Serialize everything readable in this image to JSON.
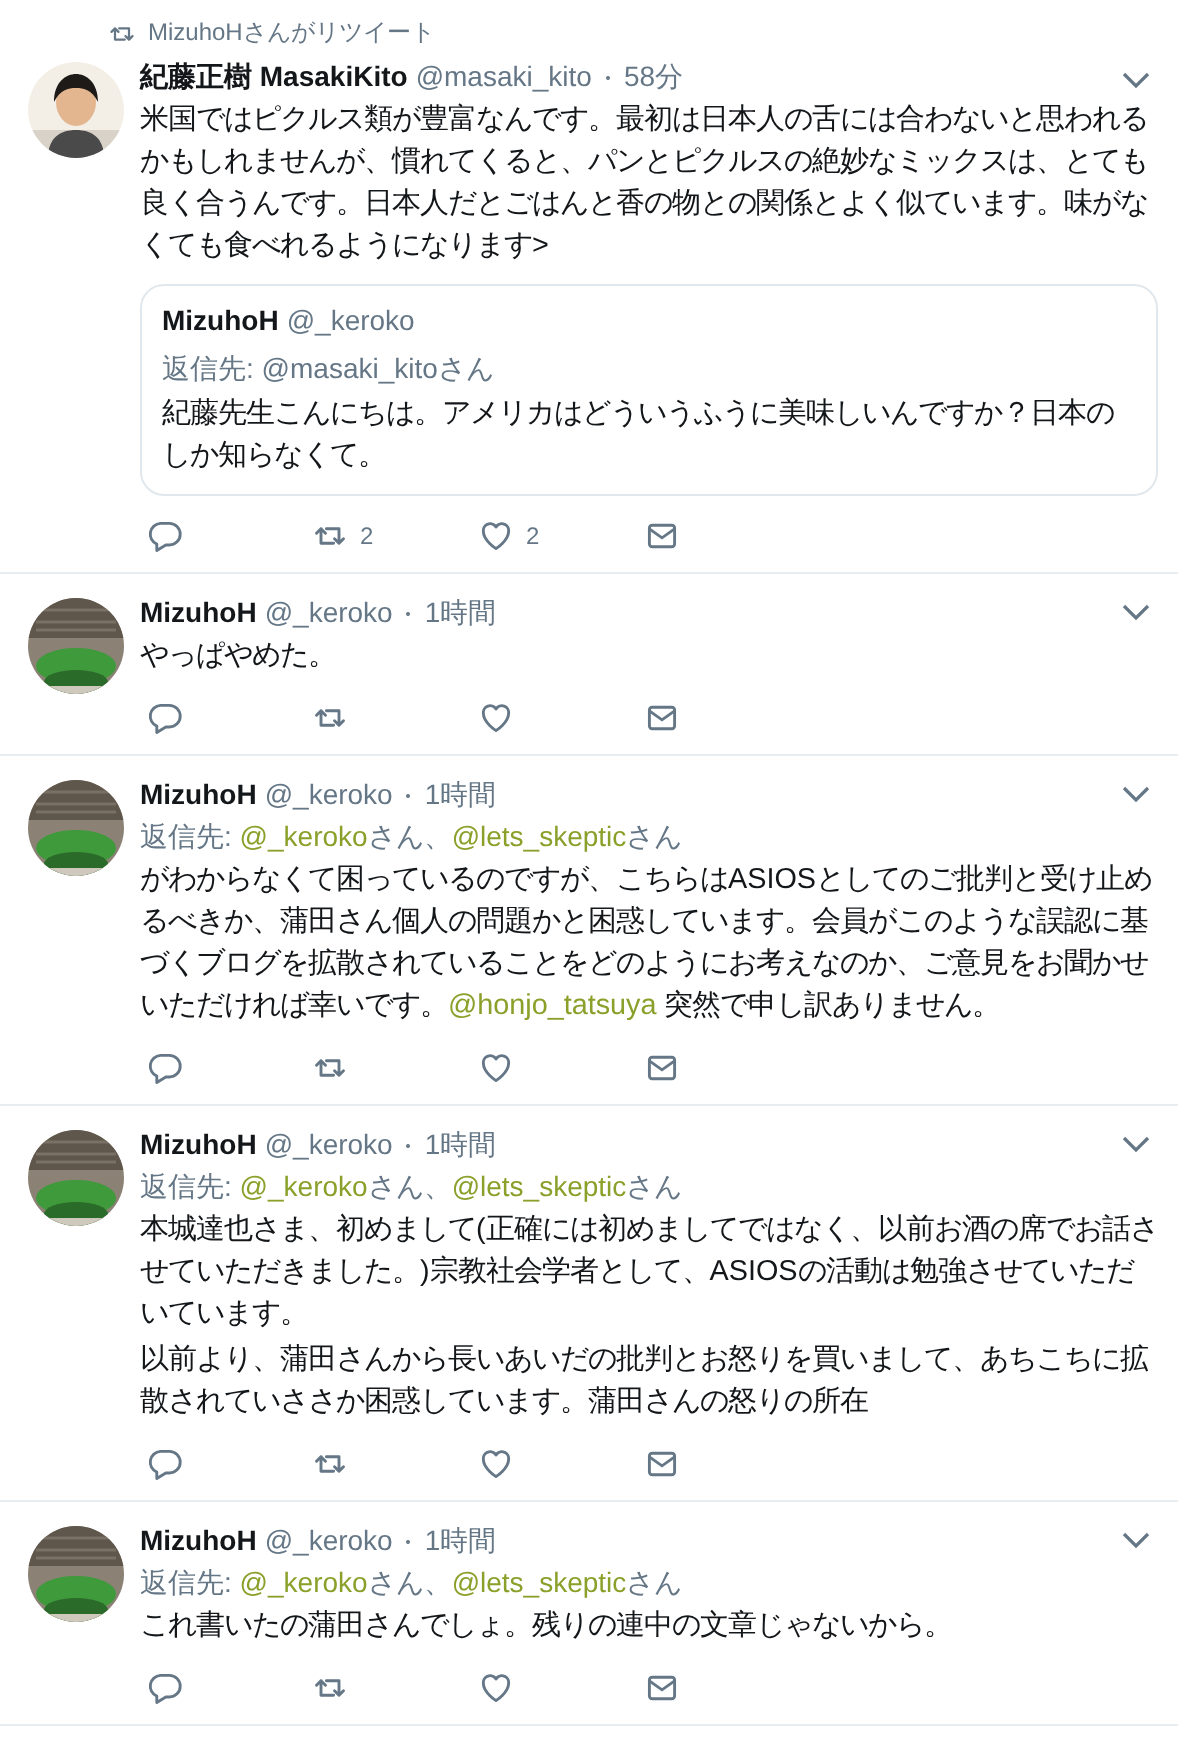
{
  "retweet_header": {
    "text": "MizuhoHさんがリツイート"
  },
  "tweets": [
    {
      "avatar": {
        "kind": "person"
      },
      "name": "紀藤正樹 MasakiKito",
      "handle": "@masaki_kito",
      "time": "58分",
      "body": [
        [
          {
            "kind": "plain",
            "text": "米国ではピクルス類が豊富なんです。最初は日本人の舌には合わないと思われるかもしれませんが、慣れてくると、パンとピクルスの絶妙なミックスは、とても良く合うんです。日本人だとごはんと香の物との関係とよく似ています。味がなくても食べれるようになります>"
          }
        ]
      ],
      "quote": {
        "name": "MizuhoH",
        "handle": "@_keroko",
        "reply_to": [
          {
            "kind": "plain",
            "text": "返信先: @masaki_kitoさん"
          }
        ],
        "body": "紀藤先生こんにちは。アメリカはどういうふうに美味しいんですか？日本のしか知らなくて。"
      },
      "actions": [
        {
          "kind": "reply"
        },
        {
          "kind": "retweet",
          "count": "2"
        },
        {
          "kind": "like",
          "count": "2"
        },
        {
          "kind": "dm"
        }
      ]
    },
    {
      "avatar": {
        "kind": "character"
      },
      "name": "MizuhoH",
      "handle": "@_keroko",
      "time": "1時間",
      "body": [
        [
          {
            "kind": "plain",
            "text": "やっぱやめた。"
          }
        ]
      ],
      "actions": [
        {
          "kind": "reply"
        },
        {
          "kind": "retweet"
        },
        {
          "kind": "like"
        },
        {
          "kind": "dm"
        }
      ]
    },
    {
      "avatar": {
        "kind": "character"
      },
      "name": "MizuhoH",
      "handle": "@_keroko",
      "time": "1時間",
      "reply_to": [
        {
          "kind": "plain",
          "text": "返信先: "
        },
        {
          "kind": "mention",
          "text": "@_keroko"
        },
        {
          "kind": "plain",
          "text": "さん、"
        },
        {
          "kind": "mention",
          "text": "@lets_skeptic"
        },
        {
          "kind": "plain",
          "text": "さん"
        }
      ],
      "body": [
        [
          {
            "kind": "plain",
            "text": "がわからなくて困っているのですが、こちらはASIOSとしてのご批判と受け止めるべきか、蒲田さん個人の問題かと困惑しています。会員がこのような誤認に基づくブログを拡散されていることをどのようにお考えなのか、ご意見をお聞かせいただければ幸いです。"
          },
          {
            "kind": "mention",
            "text": "@honjo_tatsuya"
          },
          {
            "kind": "plain",
            "text": " 突然で申し訳ありません。"
          }
        ]
      ],
      "actions": [
        {
          "kind": "reply"
        },
        {
          "kind": "retweet"
        },
        {
          "kind": "like"
        },
        {
          "kind": "dm"
        }
      ]
    },
    {
      "avatar": {
        "kind": "character"
      },
      "name": "MizuhoH",
      "handle": "@_keroko",
      "time": "1時間",
      "reply_to": [
        {
          "kind": "plain",
          "text": "返信先: "
        },
        {
          "kind": "mention",
          "text": "@_keroko"
        },
        {
          "kind": "plain",
          "text": "さん、"
        },
        {
          "kind": "mention",
          "text": "@lets_skeptic"
        },
        {
          "kind": "plain",
          "text": "さん"
        }
      ],
      "body": [
        [
          {
            "kind": "plain",
            "text": "本城達也さま、初めまして(正確には初めましてではなく、以前お酒の席でお話させていただきました。)宗教社会学者として、ASIOSの活動は勉強させていただいています。"
          }
        ],
        [
          {
            "kind": "plain",
            "text": "以前より、蒲田さんから長いあいだの批判とお怒りを買いまして、あちこちに拡散されていささか困惑しています。蒲田さんの怒りの所在"
          }
        ]
      ],
      "actions": [
        {
          "kind": "reply"
        },
        {
          "kind": "retweet"
        },
        {
          "kind": "like"
        },
        {
          "kind": "dm"
        }
      ]
    },
    {
      "avatar": {
        "kind": "character"
      },
      "name": "MizuhoH",
      "handle": "@_keroko",
      "time": "1時間",
      "reply_to": [
        {
          "kind": "plain",
          "text": "返信先: "
        },
        {
          "kind": "mention",
          "text": "@_keroko"
        },
        {
          "kind": "plain",
          "text": "さん、"
        },
        {
          "kind": "mention",
          "text": "@lets_skeptic"
        },
        {
          "kind": "plain",
          "text": "さん"
        }
      ],
      "body": [
        [
          {
            "kind": "plain",
            "text": "これ書いたの蒲田さんでしょ。残りの連中の文章じゃないから。"
          }
        ]
      ],
      "actions": [
        {
          "kind": "reply"
        },
        {
          "kind": "retweet"
        },
        {
          "kind": "like"
        },
        {
          "kind": "dm"
        }
      ]
    }
  ]
}
